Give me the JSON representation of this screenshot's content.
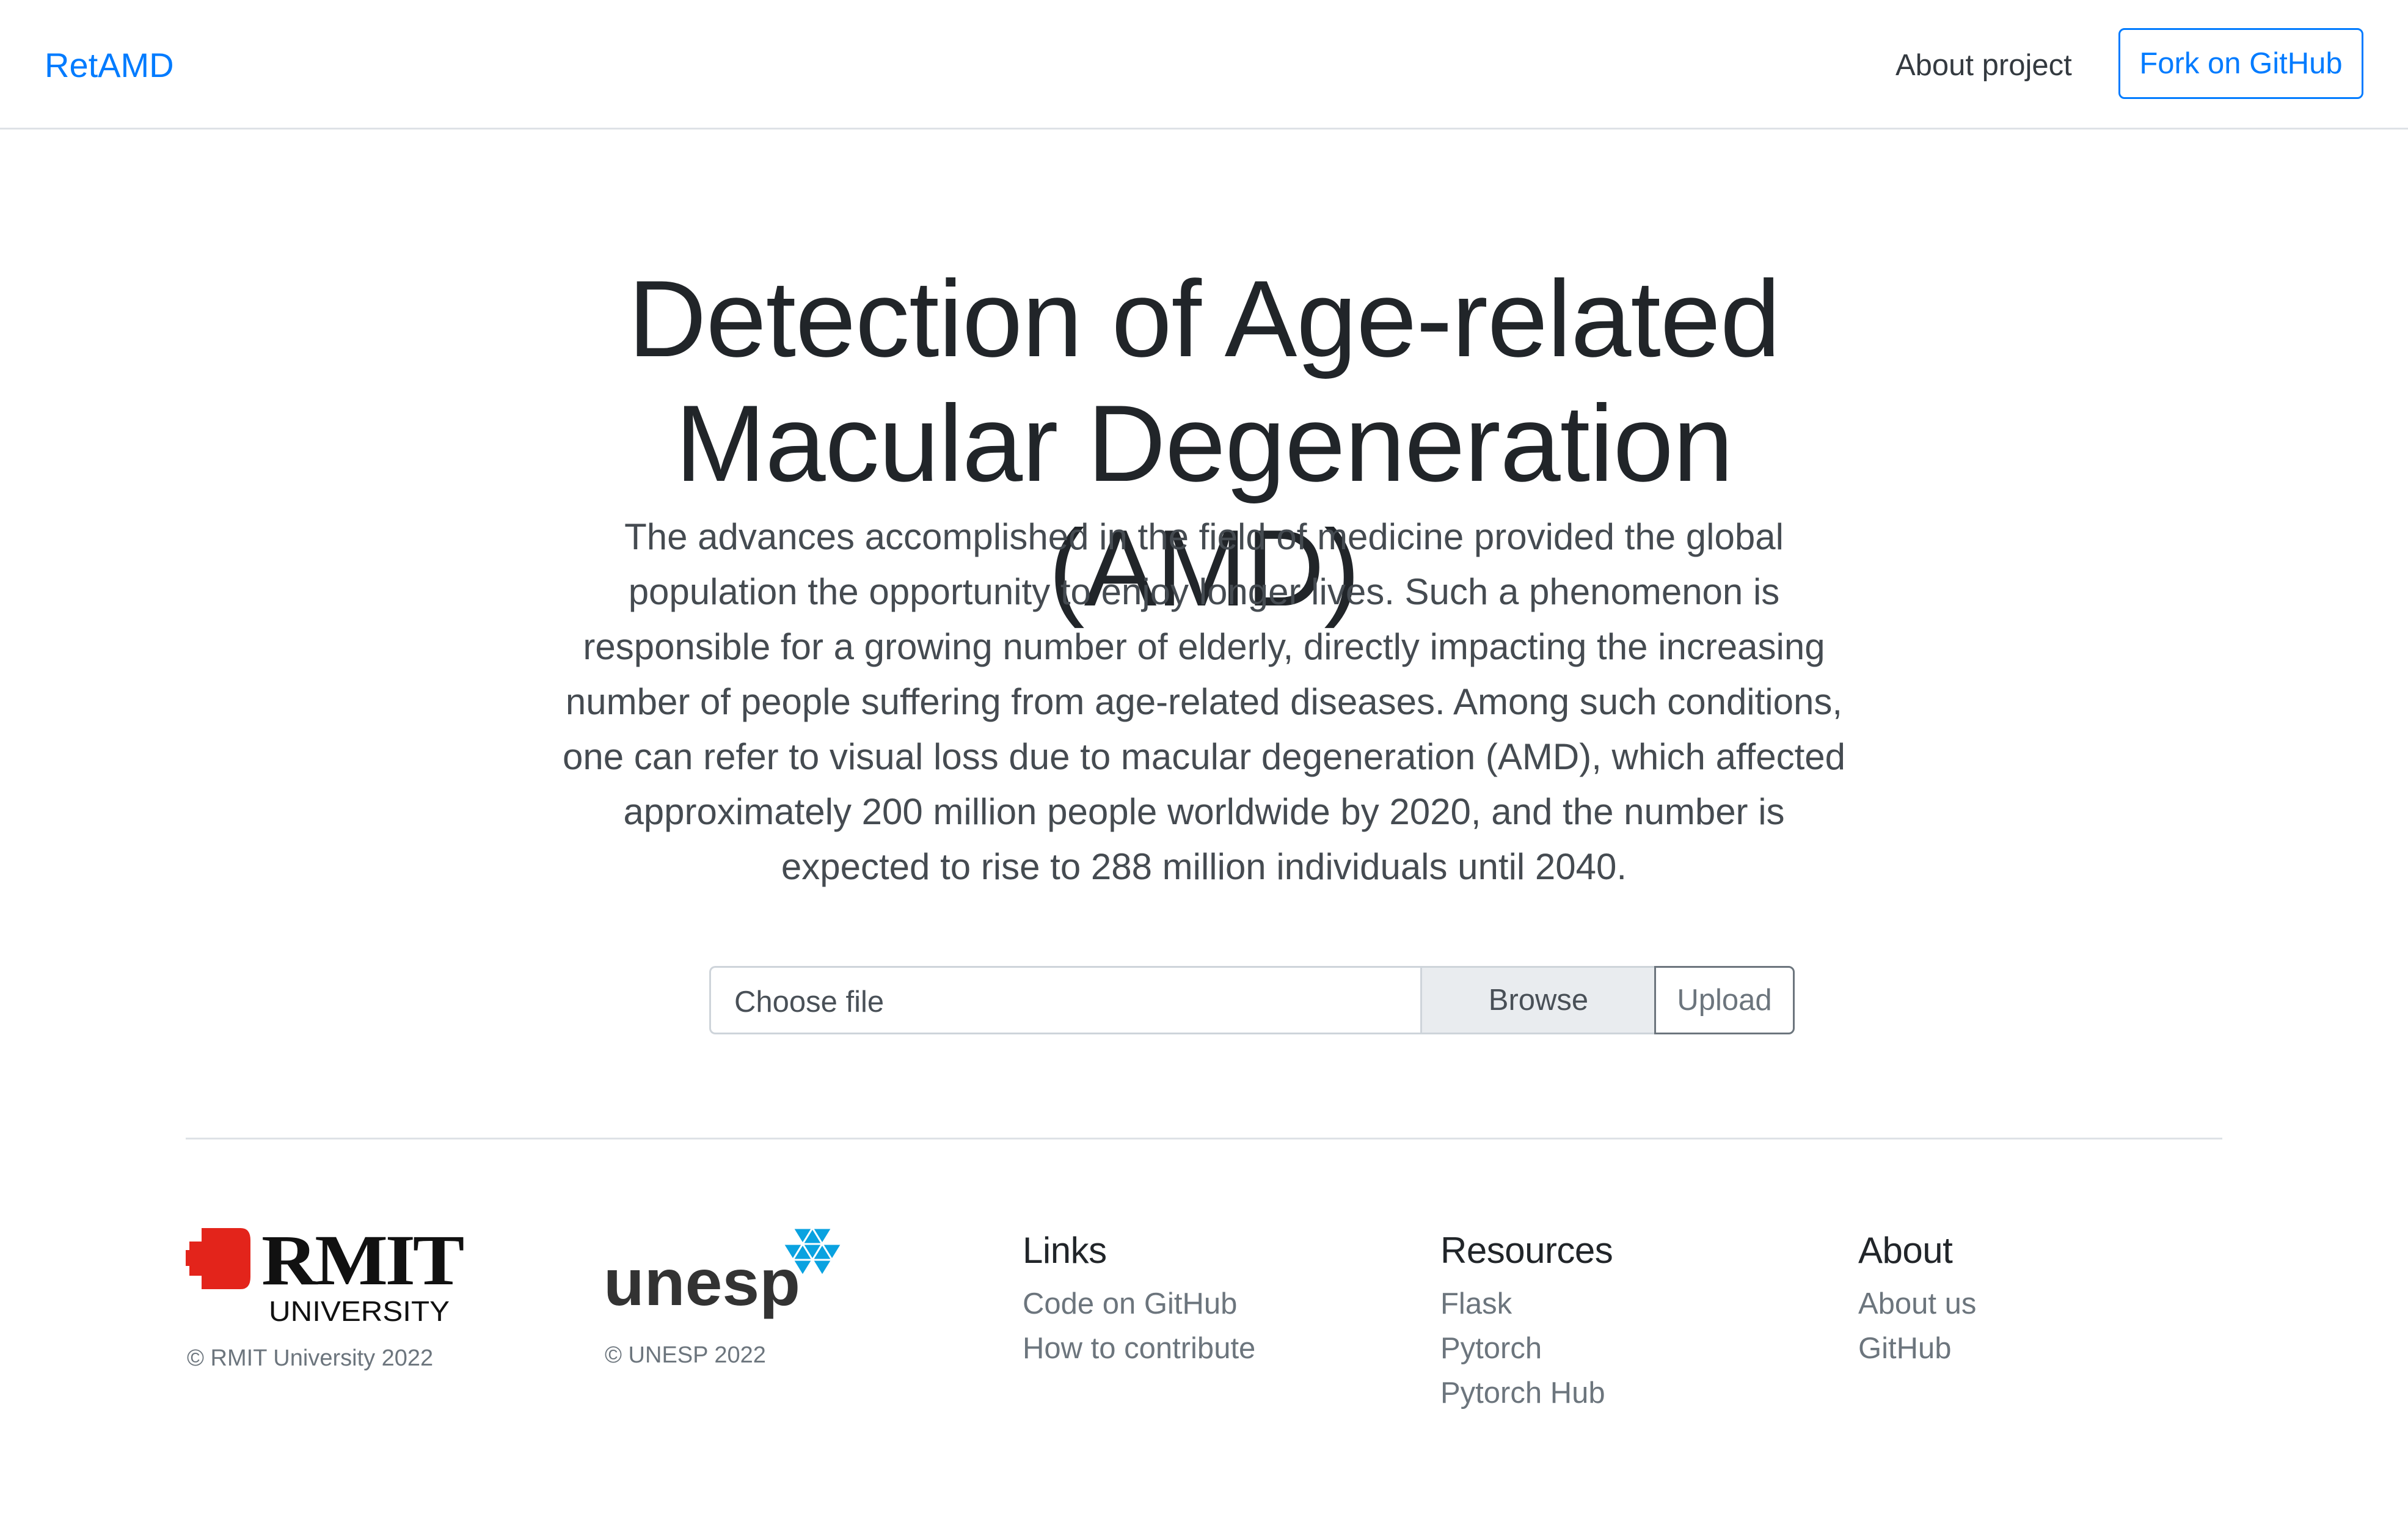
{
  "navbar": {
    "brand": "RetAMD",
    "about_link": "About project",
    "fork_button": "Fork on GitHub"
  },
  "hero": {
    "title_line1": "Detection of Age-related",
    "title_line2": "Macular Degeneration (AMD)",
    "lead": "The advances accomplished in the field of medicine provided the global population the opportunity to enjoy longer lives. Such a phenomenon is responsible for a growing number of elderly, directly impacting the increasing number of people suffering from age-related diseases. Among such conditions, one can refer to visual loss due to macular degeneration (AMD), which affected approximately 200 million people worldwide by 2020, and the number is expected to rise to 288 million individuals until 2040."
  },
  "upload": {
    "file_placeholder": "Choose file",
    "browse_label": "Browse",
    "upload_label": "Upload"
  },
  "footer": {
    "rmit": {
      "logo_text_main": "RMIT",
      "logo_text_sub": "UNIVERSITY",
      "copyright": "© RMIT University 2022"
    },
    "unesp": {
      "logo_text": "unesp",
      "copyright": "© UNESP 2022"
    },
    "links": {
      "heading": "Links",
      "items": [
        "Code on GitHub",
        "How to contribute"
      ]
    },
    "resources": {
      "heading": "Resources",
      "items": [
        "Flask",
        "Pytorch",
        "Pytorch Hub"
      ]
    },
    "about": {
      "heading": "About",
      "items": [
        "About us",
        "GitHub"
      ]
    }
  },
  "colors": {
    "brand_blue": "#007bff",
    "rmit_red": "#e3241b",
    "unesp_blue": "#0aa2e0",
    "muted": "#6c757d"
  }
}
